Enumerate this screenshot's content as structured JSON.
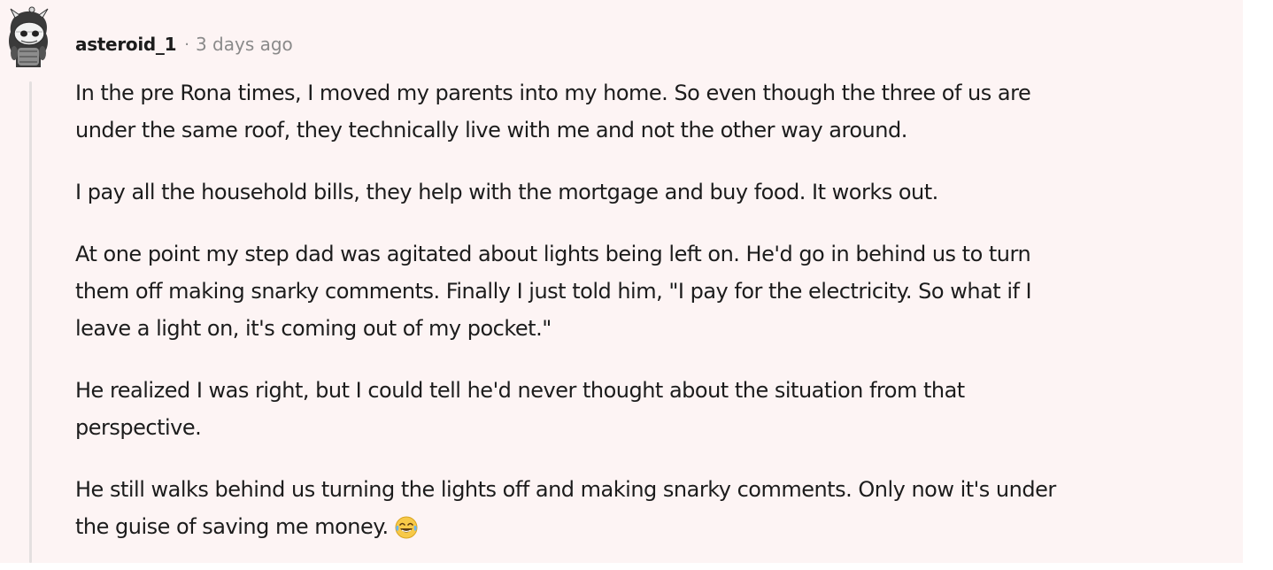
{
  "comment": {
    "username": "asteroid_1",
    "separator": "·",
    "time_ago": "3 days ago",
    "avatar_icon": "snoo-avatar-icon",
    "paragraphs": [
      {
        "lines": [
          "In the pre Rona times, I moved my parents into my home. So even though the three of us are",
          "under the same roof, they technically live with me and not the other way around."
        ]
      },
      {
        "lines": [
          "I pay all the household bills, they help with the mortgage and buy food. It works out."
        ]
      },
      {
        "lines": [
          "At one point my step dad was agitated about lights being left on. He'd go in behind us to turn",
          "them off making snarky comments. Finally I just told him, \"I pay for the electricity. So what if I",
          "leave a light on, it's coming out of my pocket.\""
        ]
      },
      {
        "lines": [
          "He realized I was right, but I could tell he'd never thought about the situation from that",
          "perspective."
        ]
      },
      {
        "lines": [
          "He still walks behind us turning the lights off and making snarky comments. Only now it's under",
          "the guise of saving me money."
        ],
        "emoji_icon": "tears-of-joy-emoji-icon"
      }
    ]
  }
}
